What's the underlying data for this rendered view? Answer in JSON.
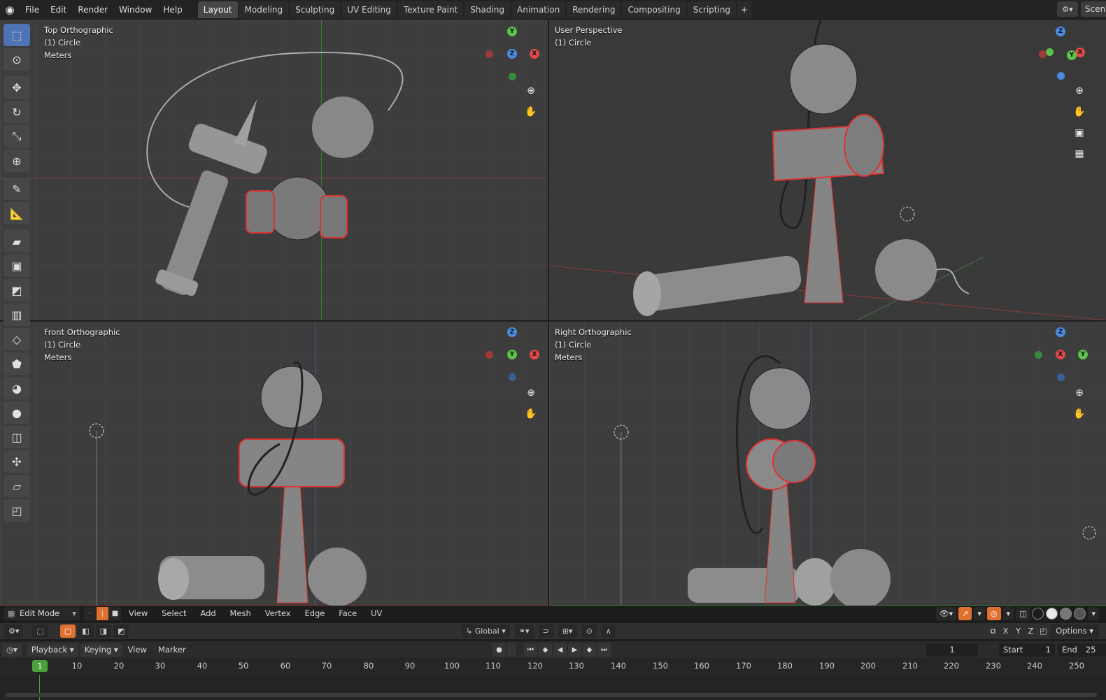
{
  "app": {
    "menu": [
      "File",
      "Edit",
      "Render",
      "Window",
      "Help"
    ],
    "workspaces": [
      "Layout",
      "Modeling",
      "Sculpting",
      "UV Editing",
      "Texture Paint",
      "Shading",
      "Animation",
      "Rendering",
      "Compositing",
      "Scripting"
    ],
    "active_workspace": "Layout",
    "add_workspace": "+",
    "scene_label": "Scen"
  },
  "viewports": {
    "top": {
      "view": "Top Orthographic",
      "object": "(1) Circle",
      "units": "Meters"
    },
    "persp": {
      "view": "User Perspective",
      "object": "(1) Circle"
    },
    "front": {
      "view": "Front Orthographic",
      "object": "(1) Circle",
      "units": "Meters"
    },
    "right": {
      "view": "Right Orthographic",
      "object": "(1) Circle",
      "units": "Meters"
    }
  },
  "gizmo": {
    "x": "X",
    "y": "Y",
    "z": "Z"
  },
  "colors": {
    "x_axis": "#e04a4a",
    "y_axis": "#5cc24b",
    "z_axis": "#4a8be0",
    "accent": "#e07030",
    "select_blue": "#4e74b5",
    "frame_green": "#4aa13a"
  },
  "header": {
    "mode": "Edit Mode",
    "menus": [
      "View",
      "Select",
      "Add",
      "Mesh",
      "Vertex",
      "Edge",
      "Face",
      "UV"
    ]
  },
  "toolsettings": {
    "orientation": "Global",
    "axes": [
      "X",
      "Y",
      "Z"
    ],
    "options": "Options"
  },
  "timeline": {
    "menus": [
      "Playback",
      "Keying"
    ],
    "plain_menus": [
      "View",
      "Marker"
    ],
    "current_frame": "1",
    "start_label": "Start",
    "start_value": "1",
    "end_label": "End",
    "end_value": "25",
    "ruler": [
      "1",
      "10",
      "20",
      "30",
      "40",
      "50",
      "60",
      "70",
      "80",
      "90",
      "100",
      "110",
      "120",
      "130",
      "140",
      "150",
      "160",
      "170",
      "180",
      "190",
      "200",
      "210",
      "220",
      "230",
      "240",
      "250"
    ]
  }
}
